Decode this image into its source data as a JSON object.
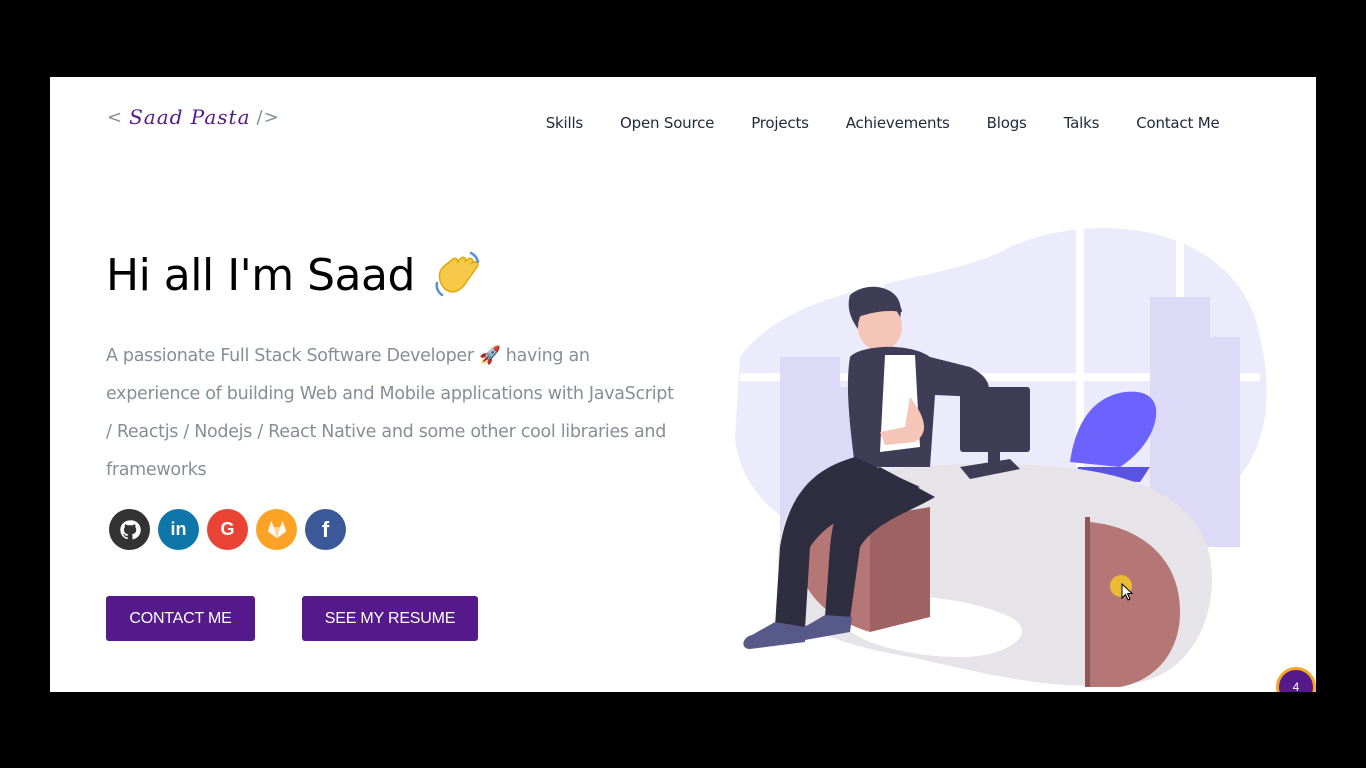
{
  "header": {
    "logo_open": "<",
    "logo_name": "Saad Pasta",
    "logo_close": "/>",
    "nav": [
      "Skills",
      "Open Source",
      "Projects",
      "Achievements",
      "Blogs",
      "Talks",
      "Contact Me"
    ]
  },
  "hero": {
    "greeting": "Hi all I'm Saad",
    "subtitle": "A passionate Full Stack Software Developer 🚀 having an experience of building Web and Mobile applications with JavaScript / Reactjs / Nodejs / React Native and some other cool libraries and frameworks",
    "social": [
      {
        "name": "github-icon",
        "glyph": "",
        "color": "#333333"
      },
      {
        "name": "linkedin-icon",
        "glyph": "in",
        "color": "#0e76a8"
      },
      {
        "name": "google-icon",
        "glyph": "G",
        "color": "#ea4335"
      },
      {
        "name": "gitlab-icon",
        "glyph": "",
        "color": "#fca326"
      },
      {
        "name": "facebook-icon",
        "glyph": "f",
        "color": "#3b5998"
      }
    ],
    "contact_button": "CONTACT ME",
    "resume_button": "SEE MY RESUME"
  },
  "badge": {
    "count": "4"
  },
  "colors": {
    "accent": "#55198b",
    "text_muted": "#868e96",
    "bg": "#ffffff"
  }
}
